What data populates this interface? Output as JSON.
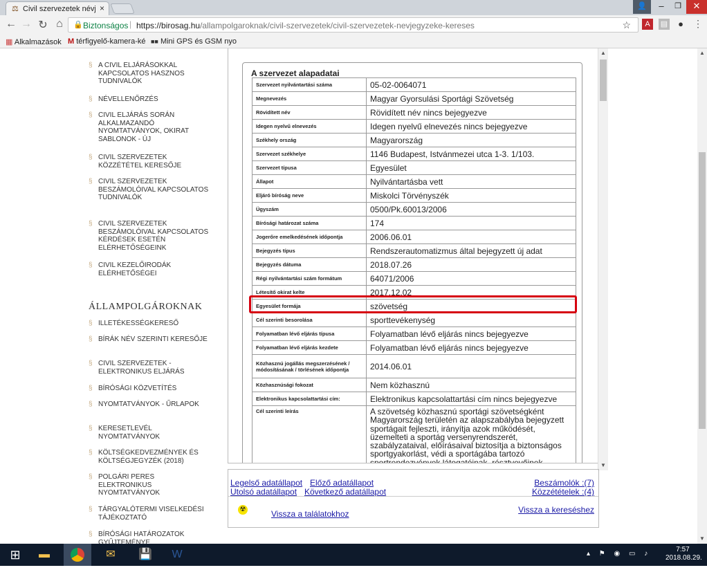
{
  "browser": {
    "tab_title": "Civil szervezetek névjegy",
    "tab_close": "×",
    "profile_icon": "person-icon",
    "omnibox": {
      "secure_label": "Biztonságos",
      "url_domain": "https://birosag.hu",
      "url_path": "/allampolgaroknak/civil-szervezetek/civil-szervezetek-nevjegyzeke-kereses"
    },
    "bookmarks": [
      {
        "label": "Alkalmazások"
      },
      {
        "label": "térfigyelő-kamera-ké"
      },
      {
        "label": "Mini GPS és GSM nyo"
      }
    ]
  },
  "sidebar": {
    "top_items": [
      "A CIVIL ELJÁRÁSOKKAL KAPCSOLATOS HASZNOS TUDNIVALÓK",
      "NÉVELLENŐRZÉS",
      "CIVIL ELJÁRÁS SORÁN ALKALMAZANDÓ NYOMTATVÁNYOK, OKIRAT SABLONOK - ÚJ",
      "CIVIL SZERVEZETEK KÖZZÉTÉTEL KERESŐJE",
      "CIVIL SZERVEZETEK BESZÁMOLÓIVAL KAPCSOLATOS TUDNIVALÓK",
      "CIVIL SZERVEZETEK BESZÁMOLÓIVAL KAPCSOLATOS KÉRDÉSEK ESETÉN ELÉRHETŐSÉGEINK",
      "CIVIL KEZELŐIRODÁK ELÉRHETŐSÉGEI"
    ],
    "section_title": "ÁLLAMPOLGÁROKNAK",
    "section_items": [
      "ILLETÉKESSÉGKERESŐ",
      "BÍRÁK NÉV SZERINTI KERESŐJE",
      "CIVIL SZERVEZETEK - ELEKTRONIKUS ELJÁRÁS",
      "BÍRÓSÁGI KÖZVETÍTÉS",
      "NYOMTATVÁNYOK - ŰRLAPOK",
      "KERESETLEVÉL NYOMTATVÁNYOK",
      "KÖLTSÉGKEDVEZMÉNYEK ÉS KÖLTSÉGJEGYZÉK (2018)",
      "POLGÁRI PERES ELEKTRONIKUS NYOMTATVÁNYOK",
      "TÁRGYALÓTERMI VISELKEDÉSI TÁJÉKOZTATÓ",
      "BÍRÓSÁGI HATÁROZATOK GYŰJTEMÉNYE"
    ]
  },
  "panel": {
    "title": "A szervezet alapadatai",
    "rows": [
      {
        "label": "Szervezet nyilvántartási száma",
        "value": "05-02-0064071"
      },
      {
        "label": "Megnevezés",
        "value": "Magyar Gyorsulási Sportági Szövetség"
      },
      {
        "label": "Rövidített név",
        "value": "Rövidített név nincs bejegyezve"
      },
      {
        "label": "Idegen nyelvű elnevezés",
        "value": "Idegen nyelvű elnevezés nincs bejegyezve"
      },
      {
        "label": "Székhely ország",
        "value": "Magyarország"
      },
      {
        "label": "Szervezet székhelye",
        "value": "1146 Budapest, Istvánmezei utca 1-3. 1/103."
      },
      {
        "label": "Szervezet típusa",
        "value": "Egyesület"
      },
      {
        "label": "Állapot",
        "value": "Nyilvántartásba vett"
      },
      {
        "label": "Eljáró bíróság neve",
        "value": "Miskolci Törvényszék"
      },
      {
        "label": "Ügyszám",
        "value": "0500/Pk.60013/2006"
      },
      {
        "label": "Bírósági határozat száma",
        "value": "174"
      },
      {
        "label": "Jogerőre emelkedésének időpontja",
        "value": "2006.06.01"
      },
      {
        "label": "Bejegyzés típus",
        "value": "Rendszerautomatizmus által bejegyzett új adat"
      },
      {
        "label": "Bejegyzés dátuma",
        "value": "2018.07.26"
      },
      {
        "label": "Régi nyilvántartási szám formátum",
        "value": "64071/2006"
      },
      {
        "label": "Létesítő okirat kelte",
        "value": "2017.12.02"
      },
      {
        "label": "Egyesület formája",
        "value": "szövetség"
      },
      {
        "label": "Cél szerinti besorolása",
        "value": "sporttevékenység"
      },
      {
        "label": "Folyamatban lévő eljárás típusa",
        "value": "Folyamatban lévő eljárás nincs bejegyezve"
      },
      {
        "label": "Folyamatban lévő eljárás kezdete",
        "value": "Folyamatban lévő eljárás nincs bejegyezve"
      },
      {
        "label": "Közhasznú jogállás megszerzésének / módosításának / törlésének időpontja",
        "value": "2014.06.01"
      },
      {
        "label": "Közhasznúsági fokozat",
        "value": "Nem közhasznú"
      },
      {
        "label": "Elektronikus kapcsolattartási cím:",
        "value": "Elektronikus kapcsolattartási cím nincs bejegyezve"
      }
    ],
    "goal_label": "Cél szerinti leírás",
    "goal_text": "A szövetség közhasznú sportági szövetségként Magyarország területén az alapszabályba bejegyzett sportágait fejleszti, irányítja azok működését, üzemelteti a sportág versenyrendszerét, szabályzataival, előírásaival biztosítja a biztonságos sportgyakorlást, védi a sportágába tartozó sportrendezvények látogatóinak, résztvevőinek biztonságát, érdek-képviseleti feladatot lát"
  },
  "navlinks": {
    "first": "Legelső adatállapot",
    "prev": "Előző adatállapot",
    "last": "Utolsó adatállapot",
    "next": "Következő adatállapot",
    "reports": "Beszámolók :(7)",
    "publications": "Közzétételek :(4)",
    "back_results": "Vissza a találatokhoz",
    "back_search": "Vissza a kereséshez"
  },
  "taskbar": {
    "time": "7:57",
    "date": "2018.08.29."
  }
}
